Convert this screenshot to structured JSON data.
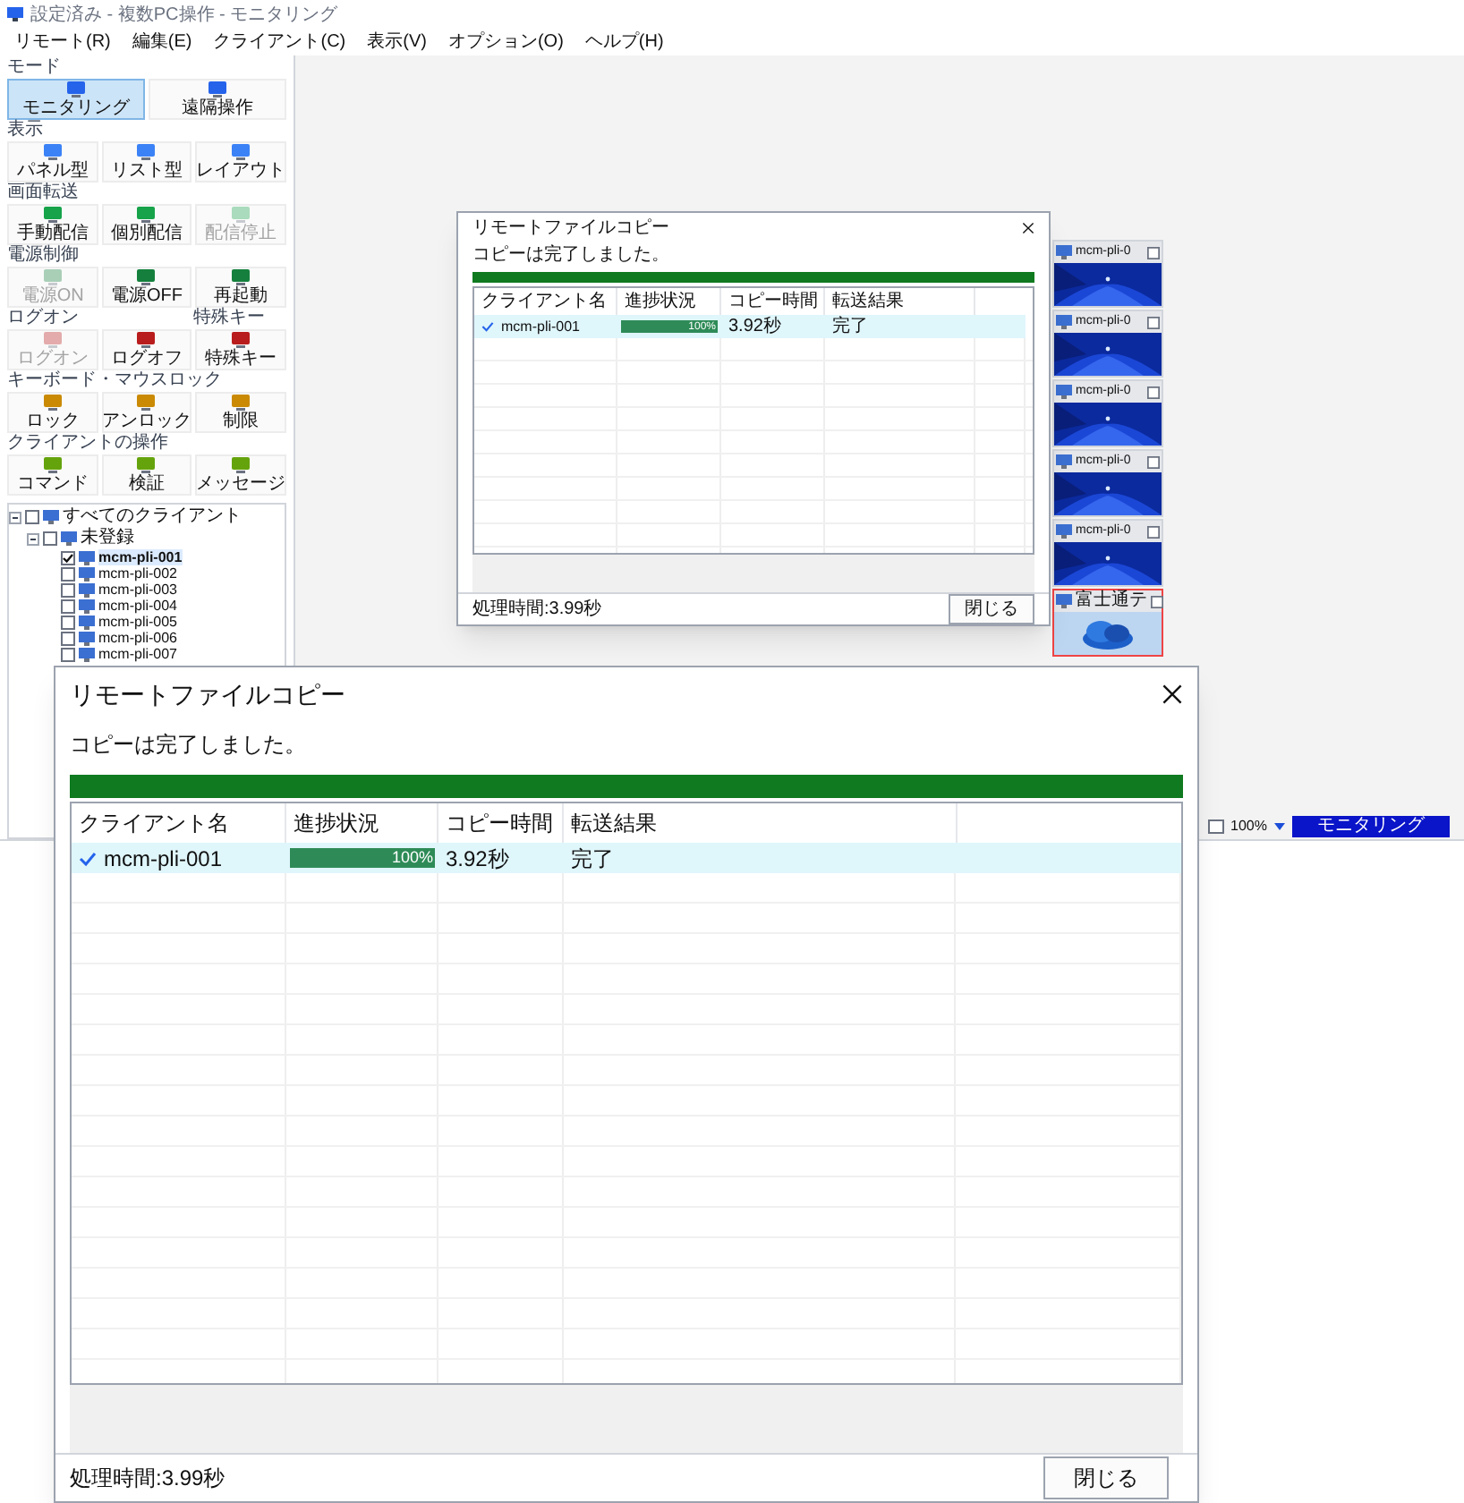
{
  "app": {
    "title": "設定済み - 複数PC操作 - モニタリング",
    "menu": [
      "リモート(R)",
      "編集(E)",
      "クライアント(C)",
      "表示(V)",
      "オプション(O)",
      "ヘルプ(H)"
    ]
  },
  "left_panel": {
    "sections": [
      {
        "titles": [
          "モード"
        ],
        "buttons": [
          {
            "label": "モニタリング",
            "selected": true,
            "disabled": false
          },
          {
            "label": "遠隔操作",
            "selected": false,
            "disabled": false
          }
        ]
      },
      {
        "titles": [
          "表示"
        ],
        "buttons": [
          {
            "label": "パネル型",
            "selected": false,
            "disabled": false
          },
          {
            "label": "リスト型",
            "selected": false,
            "disabled": false
          },
          {
            "label": "レイアウト",
            "selected": false,
            "disabled": false
          }
        ]
      },
      {
        "titles": [
          "画面転送"
        ],
        "buttons": [
          {
            "label": "手動配信",
            "selected": false,
            "disabled": false
          },
          {
            "label": "個別配信",
            "selected": false,
            "disabled": false
          },
          {
            "label": "配信停止",
            "selected": false,
            "disabled": true
          }
        ]
      },
      {
        "titles": [
          "電源制御"
        ],
        "buttons": [
          {
            "label": "電源ON",
            "selected": false,
            "disabled": true
          },
          {
            "label": "電源OFF",
            "selected": false,
            "disabled": false
          },
          {
            "label": "再起動",
            "selected": false,
            "disabled": false
          }
        ]
      },
      {
        "titles": [
          "ログオン",
          "特殊キー"
        ],
        "buttons": [
          {
            "label": "ログオン",
            "selected": false,
            "disabled": true
          },
          {
            "label": "ログオフ",
            "selected": false,
            "disabled": false
          },
          {
            "label": "特殊キー",
            "selected": false,
            "disabled": false
          }
        ]
      },
      {
        "titles": [
          "キーボード・マウスロック"
        ],
        "buttons": [
          {
            "label": "ロック",
            "selected": false,
            "disabled": false
          },
          {
            "label": "アンロック",
            "selected": false,
            "disabled": false
          },
          {
            "label": "制限",
            "selected": false,
            "disabled": false
          }
        ]
      },
      {
        "titles": [
          "クライアントの操作"
        ],
        "buttons": [
          {
            "label": "コマンド",
            "selected": false,
            "disabled": false
          },
          {
            "label": "検証",
            "selected": false,
            "disabled": false
          },
          {
            "label": "メッセージ",
            "selected": false,
            "disabled": false
          }
        ]
      }
    ],
    "tree": [
      {
        "label": "すべてのクライアント",
        "checked": false,
        "expanded": true,
        "selected": false,
        "children": [
          {
            "label": "未登録",
            "checked": false,
            "expanded": true,
            "selected": false,
            "children": [
              {
                "label": "mcm-pli-001",
                "checked": true,
                "selected": true
              },
              {
                "label": "mcm-pli-002",
                "checked": false,
                "selected": false
              },
              {
                "label": "mcm-pli-003",
                "checked": false,
                "selected": false
              },
              {
                "label": "mcm-pli-004",
                "checked": false,
                "selected": false
              },
              {
                "label": "mcm-pli-005",
                "checked": false,
                "selected": false
              },
              {
                "label": "mcm-pli-006",
                "checked": false,
                "selected": false
              },
              {
                "label": "mcm-pli-007",
                "checked": false,
                "selected": false
              }
            ]
          }
        ]
      }
    ]
  },
  "thumbnails": [
    {
      "label": "mcm-pli-0",
      "selected": false,
      "checked": false
    },
    {
      "label": "mcm-pli-0",
      "selected": false,
      "checked": false
    },
    {
      "label": "mcm-pli-0",
      "selected": false,
      "checked": false
    },
    {
      "label": "mcm-pli-0",
      "selected": false,
      "checked": false
    },
    {
      "label": "mcm-pli-0",
      "selected": false,
      "checked": false
    },
    {
      "label": "富士通テ",
      "selected": true,
      "checked": false
    }
  ],
  "status_bar": {
    "zoom": "100%",
    "mode": "モニタリング"
  },
  "dialogs": [
    {
      "title": "リモートファイルコピー",
      "message": "コピーは完了しました。",
      "level": 1,
      "columns": [
        "クライアント名",
        "進捗状況",
        "コピー時間",
        "転送結果"
      ],
      "rows": [
        {
          "name": "mcm-pli-001",
          "done": true,
          "level": 1,
          "reading": "100%",
          "time": "3.92秒",
          "result": "完了"
        }
      ],
      "elapsed": "処理時間:3.99秒",
      "close": "閉じる"
    },
    {
      "title": "リモートファイルコピー",
      "message": "コピーは完了しました。",
      "level": 1,
      "columns": [
        "クライアント名",
        "進捗状況",
        "コピー時間",
        "転送結果"
      ],
      "rows": [
        {
          "name": "mcm-pli-001",
          "done": true,
          "level": 1,
          "reading": "100%",
          "time": "3.92秒",
          "result": "完了"
        }
      ],
      "elapsed": "処理時間:3.99秒",
      "close": "閉じる"
    }
  ]
}
